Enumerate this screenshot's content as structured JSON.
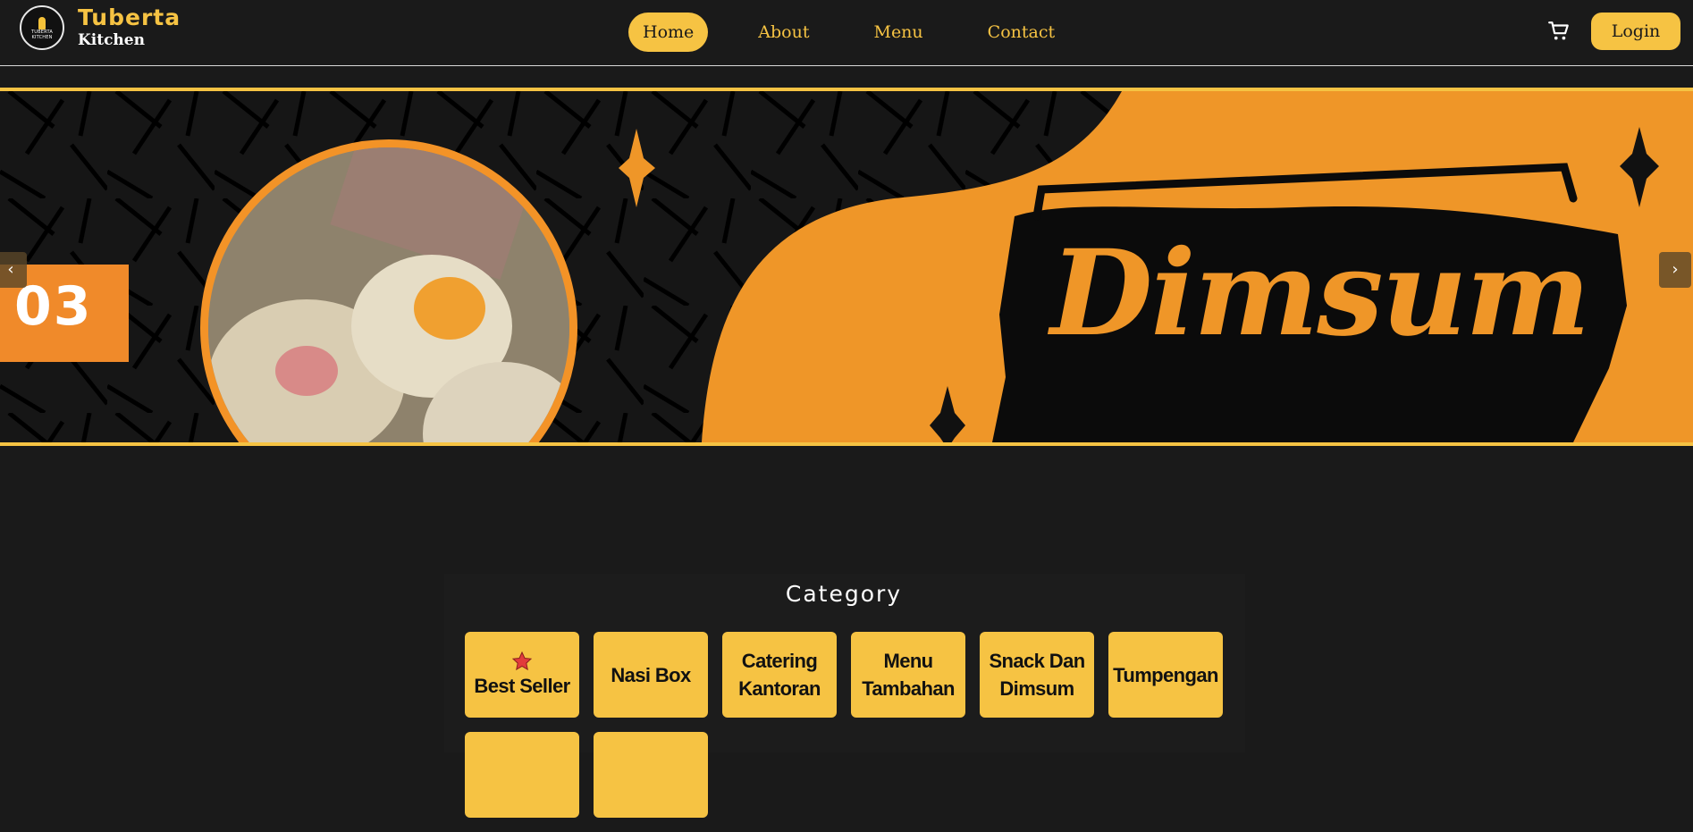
{
  "brand": {
    "name": "Tuberta",
    "tagline": "Kitchen",
    "logo_text_line1": "TUBERTA",
    "logo_text_line2": "KITCHEN"
  },
  "nav": {
    "items": [
      {
        "label": "Home",
        "active": true
      },
      {
        "label": "About",
        "active": false
      },
      {
        "label": "Menu",
        "active": false
      },
      {
        "label": "Contact",
        "active": false
      }
    ],
    "cart_icon": "cart-icon",
    "login_label": "Login"
  },
  "hero": {
    "slide_number": "03",
    "slide_title": "Dimsum",
    "prev_icon": "chevron-left-icon",
    "next_icon": "chevron-right-icon"
  },
  "category": {
    "title": "Category",
    "items": [
      {
        "label": "Best Seller",
        "icon": "star-icon"
      },
      {
        "label": "Nasi Box"
      },
      {
        "label": "Catering Kantoran"
      },
      {
        "label": "Menu Tambahan"
      },
      {
        "label": "Snack Dan Dimsum"
      },
      {
        "label": "Tumpengan"
      },
      {
        "label": ""
      },
      {
        "label": ""
      }
    ]
  },
  "colors": {
    "accent": "#f6c343",
    "orange": "#f08a2a",
    "background": "#1a1a1a"
  }
}
